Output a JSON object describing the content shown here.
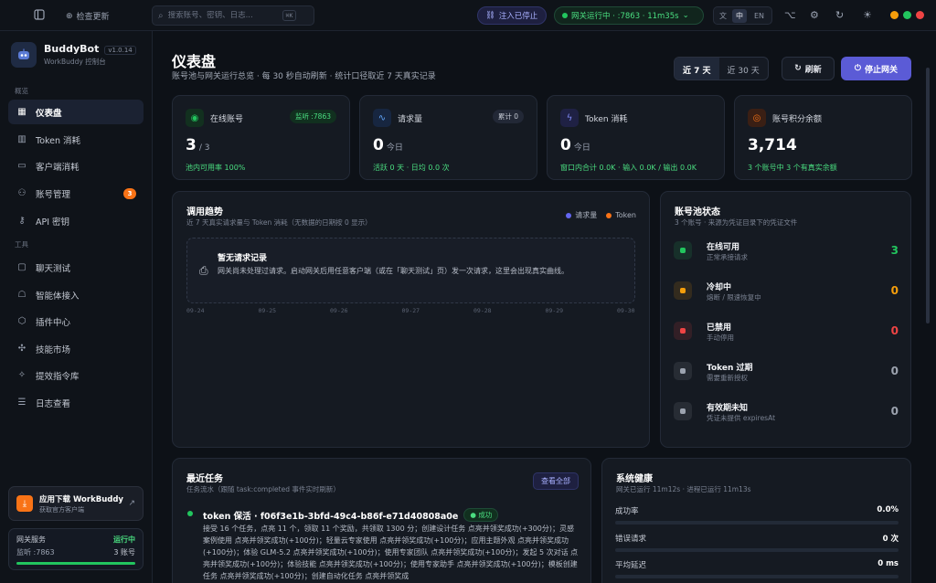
{
  "topbar": {
    "check_update": "检查更新",
    "search_placeholder": "搜索账号、密钥、日志...",
    "search_kbd": "⌘K",
    "inject_label": "注入已停止",
    "gateway_status": "网关运行中 · :7863 · 11m35s",
    "lang_zh": "中",
    "lang_en": "EN"
  },
  "sidebar": {
    "brand": "BuddyBot",
    "version": "v1.0.14",
    "brand_sub": "WorkBuddy 控制台",
    "section_overview": "概览",
    "section_tools": "工具",
    "items": [
      {
        "label": "仪表盘",
        "icon": "dashboard-icon"
      },
      {
        "label": "Token 消耗",
        "icon": "bar-chart-icon"
      },
      {
        "label": "客户端消耗",
        "icon": "window-icon"
      },
      {
        "label": "账号管理",
        "icon": "users-icon",
        "badge": "3"
      },
      {
        "label": "API 密钥",
        "icon": "key-icon"
      },
      {
        "label": "聊天测试",
        "icon": "chat-icon"
      },
      {
        "label": "智能体接入",
        "icon": "robot-icon"
      },
      {
        "label": "插件中心",
        "icon": "cube-icon"
      },
      {
        "label": "技能市场",
        "icon": "puzzle-icon"
      },
      {
        "label": "提效指令库",
        "icon": "sparkle-icon"
      },
      {
        "label": "日志查看",
        "icon": "log-icon"
      }
    ],
    "download": {
      "title": "应用下载 WorkBuddy",
      "sub": "获取官方客户端"
    },
    "gateway": {
      "label": "网关服务",
      "status": "运行中",
      "port": "监听 :7863",
      "accounts": "3 账号",
      "progress": 1.0
    }
  },
  "header": {
    "title": "仪表盘",
    "subtitle": "账号池与网关运行总览 · 每 30 秒自动刷新 · 统计口径取近 7 天真实记录",
    "range_7": "近 7 天",
    "range_30": "近 30 天",
    "refresh": "刷新",
    "stop_gateway": "停止网关"
  },
  "stats": [
    {
      "label": "在线账号",
      "tag": "监听 :7863",
      "value": "3",
      "suffix": "/ 3",
      "foot": "池内可用率 100%",
      "icon": "user-circle-icon",
      "color": "#22c55e"
    },
    {
      "label": "请求量",
      "tag": "累计 0",
      "value": "0",
      "suffix": "今日",
      "foot": "活跃 0 天 · 日均 0.0 次",
      "icon": "activity-icon",
      "color": "#60a5fa"
    },
    {
      "label": "Token 消耗",
      "tag": "",
      "value": "0",
      "suffix": "今日",
      "foot": "窗口内合计 0.0K · 输入 0.0K / 输出 0.0K",
      "icon": "bolt-icon",
      "color": "#818cf8"
    },
    {
      "label": "账号积分余额",
      "tag": "",
      "value": "3,714",
      "suffix": "",
      "foot": "3 个账号中 3 个有真实余额",
      "icon": "coins-icon",
      "color": "#f97316"
    }
  ],
  "trend": {
    "title": "调用趋势",
    "sub": "近 7 天真实请求量与 Token 消耗（无数据的日期按 0 显示）",
    "legend_requests": "请求量",
    "legend_token": "Token",
    "color_requests": "#6366f1",
    "color_token": "#f97316",
    "empty_title": "暂无请求记录",
    "empty_desc": "网关尚未处理过请求。启动网关后用任意客户端（或在「聊天测试」页）发一次请求，这里会出现真实曲线。",
    "xticks": [
      "09-24",
      "09-25",
      "09-26",
      "09-27",
      "09-28",
      "09-29",
      "09-30"
    ]
  },
  "pool": {
    "title": "账号池状态",
    "sub": "3 个账号 · 来源为凭证目录下的凭证文件",
    "rows": [
      {
        "name": "在线可用",
        "desc": "正常承接请求",
        "value": "3",
        "color": "#22c55e"
      },
      {
        "name": "冷却中",
        "desc": "熔断 / 限速恢复中",
        "value": "0",
        "color": "#f59e0b"
      },
      {
        "name": "已禁用",
        "desc": "手动停用",
        "value": "0",
        "color": "#ef4444"
      },
      {
        "name": "Token 过期",
        "desc": "需要重新授权",
        "value": "0",
        "color": "#9ca3af"
      },
      {
        "name": "有效期未知",
        "desc": "凭证未提供 expiresAt",
        "value": "0",
        "color": "#9ca3af"
      }
    ]
  },
  "tasks": {
    "title": "最近任务",
    "sub": "任务流水（跟随 task:completed 事件实时刷新）",
    "view_all": "查看全部",
    "item_title": "token 保活 · f06f3e1b-3bfd-49c4-b86f-e71d40808a0e",
    "item_status": "成功",
    "item_body": "接受 16 个任务，点亮 11 个，领取 11 个奖励，共领取 1300 分；创建设计任务 点亮并领奖成功(+300分)；灵感案例使用 点亮并领奖成功(+100分)；轻量云专家使用 点亮并领奖成功(+100分)；应用主题外观 点亮并领奖成功(+100分)；体验 GLM-5.2 点亮并领奖成功(+100分)；使用专家团队 点亮并领奖成功(+100分)；发起 5 次对话 点亮并领奖成功(+100分)；体验技能 点亮并领奖成功(+100分)；使用专家助手 点亮并领奖成功(+100分)；模板创建任务 点亮并领奖成功(+100分)；创建自动化任务 点亮并领奖成"
  },
  "health": {
    "title": "系统健康",
    "sub": "网关已运行 11m12s · 进程已运行 11m13s",
    "rows": [
      {
        "label": "成功率",
        "value": "0.0%"
      },
      {
        "label": "错误请求",
        "value": "0 次"
      },
      {
        "label": "平均延迟",
        "value": "0 ms"
      }
    ]
  }
}
